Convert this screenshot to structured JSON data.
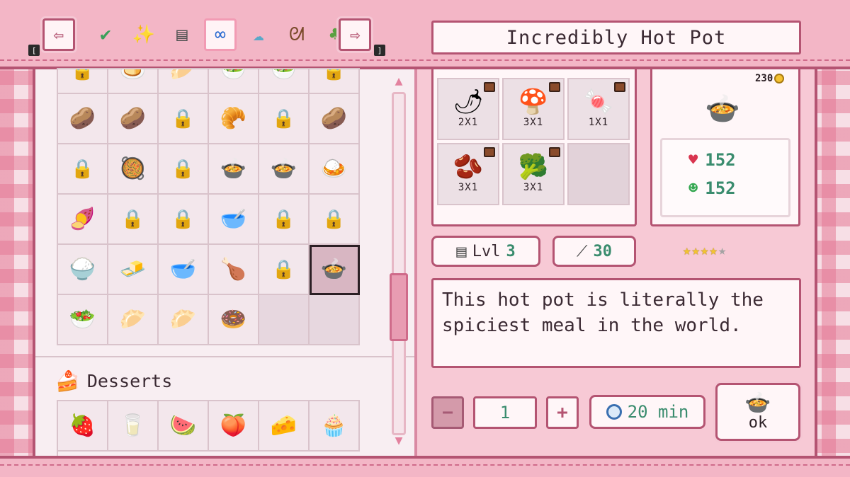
{
  "header": {
    "title": "Incredibly Hot Pot",
    "prev_key": "[",
    "next_key": "]",
    "categories": [
      {
        "name": "check-icon",
        "glyph": "✔"
      },
      {
        "name": "sparkle-icon",
        "glyph": "✨"
      },
      {
        "name": "stove-icon",
        "glyph": "▤"
      },
      {
        "name": "infinity-icon",
        "glyph": "∞",
        "selected": true
      },
      {
        "name": "dumpling-icon",
        "glyph": "☁"
      },
      {
        "name": "pretzel-icon",
        "glyph": "ᘛ"
      },
      {
        "name": "salad-icon",
        "glyph": "♣"
      }
    ]
  },
  "recipes": {
    "rows": [
      [
        "🔒",
        "🍮",
        "🥟",
        "🥗",
        "🥗",
        "🔒"
      ],
      [
        "🥔",
        "🥔",
        "🔒",
        "🥐",
        "🔒",
        "🥔"
      ],
      [
        "🔒",
        "🥘",
        "🔒",
        "🍲",
        "🍲",
        "🍛"
      ],
      [
        "🍠",
        "🔒",
        "🔒",
        "🥣",
        "🔒",
        "🔒"
      ],
      [
        "🍚",
        "🧈",
        "🥣",
        "🍗",
        "🔒",
        "🍲"
      ],
      [
        "🥗",
        "🥟",
        "🥟",
        "🍩",
        "",
        ""
      ]
    ],
    "selected": [
      4,
      5
    ]
  },
  "desserts": {
    "label": "Desserts",
    "icon": "🍰",
    "items": [
      "🍓",
      "🥛",
      "🍉",
      "🍑",
      "🧀",
      "🧁"
    ]
  },
  "ingredients": [
    {
      "icon": "🌶",
      "qty": "2X1"
    },
    {
      "icon": "🍄",
      "qty": "3X1"
    },
    {
      "icon": "🍬",
      "qty": "1X1"
    },
    {
      "icon": "🫘",
      "qty": "3X1"
    },
    {
      "icon": "🥦",
      "qty": "3X1"
    }
  ],
  "dish": {
    "price": "230",
    "icon": "🍲",
    "health": "152",
    "energy": "152"
  },
  "info": {
    "level_label": "Lvl",
    "level": "3",
    "xp": "30",
    "stars": 4,
    "stars_max": 5,
    "description": "This hot pot is literally the spiciest meal in the world."
  },
  "cook": {
    "quantity": "1",
    "time": "20 min",
    "ok_label": "ok"
  },
  "colors": {
    "accent": "#b45472",
    "value_green": "#3a8c6e"
  }
}
